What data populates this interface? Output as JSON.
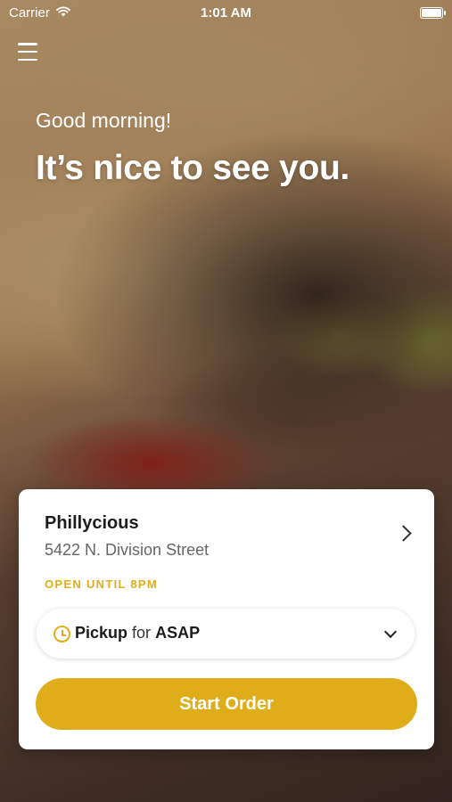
{
  "status_bar": {
    "carrier": "Carrier",
    "time": "1:01 AM"
  },
  "header": {
    "greeting": "Good morning!",
    "headline": "It’s nice to see you."
  },
  "store": {
    "name": "Phillycious",
    "address": "5422 N. Division Street",
    "hours": "OPEN UNTIL 8PM"
  },
  "order": {
    "mode": "Pickup",
    "connector": "for",
    "time": "ASAP",
    "start_label": "Start Order"
  },
  "colors": {
    "accent": "#e0ad1a",
    "card_bg": "#ffffff"
  },
  "icons": [
    "menu-icon",
    "wifi-icon",
    "battery-icon",
    "chevron-right-icon",
    "clock-icon",
    "chevron-down-icon"
  ]
}
